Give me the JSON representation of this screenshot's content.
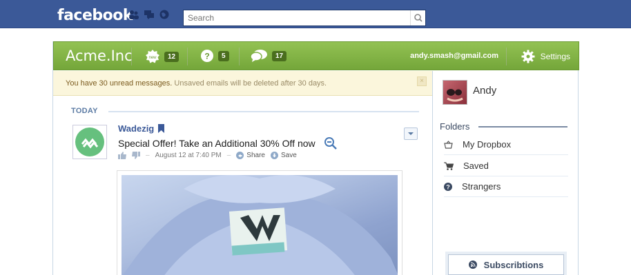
{
  "facebook": {
    "logo": "facebook",
    "search_placeholder": "Search",
    "colors": {
      "bar": "#3b5998"
    },
    "icons": [
      "friends-icon",
      "messages-icon",
      "globe-icon"
    ]
  },
  "header": {
    "brand": "Acme.Inc",
    "new_badge": "new",
    "new_count": "12",
    "questions_count": "5",
    "messages_count": "17",
    "email": "andy.smash@gmail.com",
    "settings_label": "Settings",
    "colors": {
      "bar": "#7fb043",
      "badge": "#4a6e1e"
    }
  },
  "notice": {
    "bold_text": "You have 30 unread messages.",
    "rest_text": " Unsaved emails will be deleted after 30 days.",
    "close": "×"
  },
  "feed": {
    "section_label": "TODAY",
    "post": {
      "author": "Wadezig",
      "title": "Special Offer! Take an Additional 30% Off now",
      "date": "August 12 at 7:40 PM",
      "share_label": "Share",
      "save_label": "Save"
    }
  },
  "sidebar": {
    "user_name": "Andy",
    "folders_label": "Folders",
    "folders": [
      {
        "label": "My Dropbox",
        "icon": "basket-icon"
      },
      {
        "label": "Saved",
        "icon": "cart-icon"
      },
      {
        "label": "Strangers",
        "icon": "question-icon"
      }
    ],
    "subscriptions_label": "Subscribtions"
  }
}
